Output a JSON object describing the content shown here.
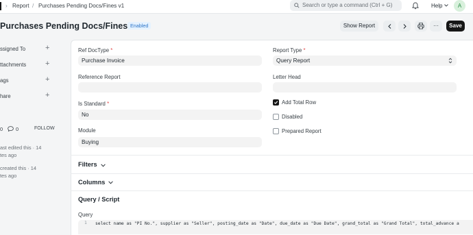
{
  "breadcrumb": {
    "item1": "Report",
    "separator": "/",
    "item2": "Purchases Pending Docs/Fines v1"
  },
  "search": {
    "placeholder": "Search or type a command (Ctrl + G)"
  },
  "nav": {
    "help_label": "Help",
    "avatar_initial": "A"
  },
  "page": {
    "title": "Purchases Pending Docs/Fines v1",
    "status": "Enabled",
    "show_report_label": "Show Report",
    "save_label": "Save",
    "more_glyph": "···"
  },
  "sidebar": {
    "items": [
      {
        "label": "ssigned To",
        "icon": "plus-icon"
      },
      {
        "label": "ttachments",
        "icon": "plus-icon"
      },
      {
        "label": "ags",
        "icon": "plus-icon"
      },
      {
        "label": "hare",
        "icon": "plus-icon"
      }
    ],
    "likes_count": "0",
    "comments_count": "0",
    "follow_label": "FOLLOW",
    "edited_line1": "ast edited this · 14",
    "edited_line2": "tes ago",
    "created_line1": "created this · 14",
    "created_line2": "tes ago"
  },
  "form": {
    "ref_doctype_label": "Ref DocType",
    "ref_doctype_value": "Purchase Invoice",
    "reference_report_label": "Reference Report",
    "reference_report_value": "",
    "is_standard_label": "Is Standard",
    "is_standard_value": "No",
    "module_label": "Module",
    "module_value": "Buying",
    "report_type_label": "Report Type",
    "report_type_value": "Query Report",
    "letter_head_label": "Letter Head",
    "letter_head_value": "",
    "required_mark": "*",
    "checkboxes": [
      {
        "label": "Add Total Row",
        "checked": true
      },
      {
        "label": "Disabled",
        "checked": false
      },
      {
        "label": "Prepared Report",
        "checked": false
      }
    ]
  },
  "sections": {
    "filters": "Filters",
    "columns": "Columns",
    "query_script": "Query / Script",
    "query_label": "Query"
  },
  "query": {
    "line_number": "1",
    "text": "select name as \"PI No.\", supplier as \"Seller\", posting_date as \"Date\", due_date as \"Due Date\", grand_total as \"Grand Total\", total_advance a"
  },
  "colors": {
    "accent_dark": "#171717",
    "badge_blue": "#2b74c7",
    "required_red": "#e24c4c",
    "avatar_green": "#2d8f49"
  }
}
